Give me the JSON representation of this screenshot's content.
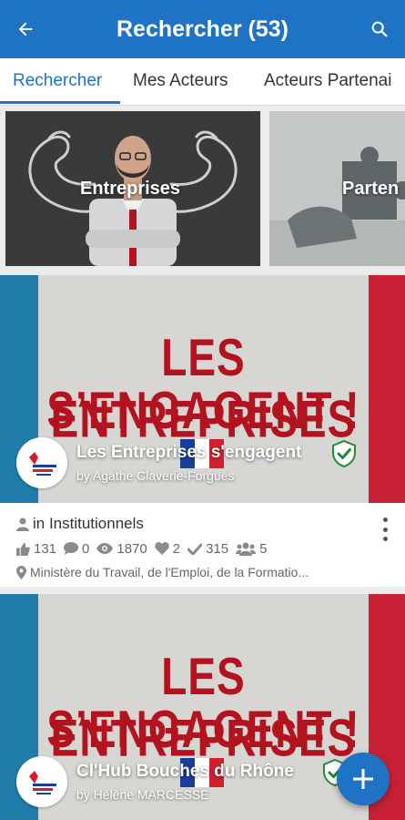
{
  "header": {
    "title": "Rechercher (53)",
    "back_icon": "arrow-left-icon",
    "search_icon": "search-icon",
    "color": "#1f73c4"
  },
  "tabs": [
    {
      "label": "Rechercher",
      "active": true
    },
    {
      "label": "Mes Acteurs",
      "active": false
    },
    {
      "label": "Acteurs Partenai",
      "active": false
    }
  ],
  "categories": [
    {
      "label": "Entreprises"
    },
    {
      "label": "Parten"
    }
  ],
  "cards": [
    {
      "banner_line1": "LES ENTREPRISES",
      "banner_line2": "S’ENGAGENT !",
      "title": "Les Entreprises s'engagent",
      "author": "by Agathe  Claverie-Forgues",
      "verified": true,
      "category": "in Institutionnels",
      "stats": {
        "likes": "131",
        "comments": "0",
        "views": "1870",
        "hearts": "2",
        "checks": "315",
        "members": "5"
      },
      "location": "Ministère du Travail, de l'Emploi, de la Formatio..."
    },
    {
      "banner_line1": "LES ENTREPRISES",
      "banner_line2": "S’ENGAGENT !",
      "title": "Cl'Hub Bouches du Rhône",
      "author": "by Hélène MARCESSE",
      "verified": true
    }
  ],
  "fab": {
    "icon": "plus-icon"
  }
}
